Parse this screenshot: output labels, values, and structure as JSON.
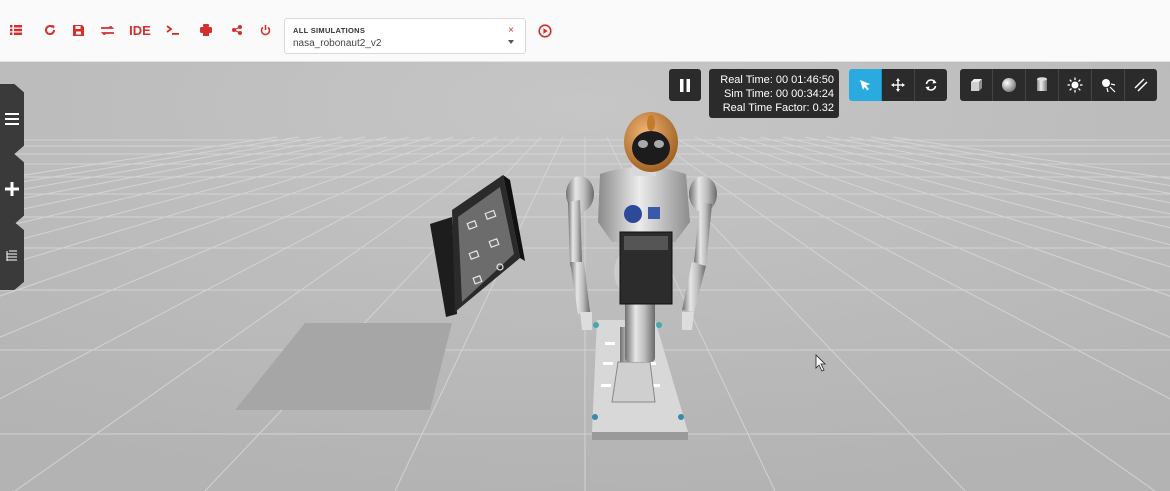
{
  "toolbar": {
    "items": [
      {
        "icon": "list-icon",
        "label": ""
      },
      {
        "icon": "refresh-icon",
        "label": ""
      },
      {
        "icon": "save-icon",
        "label": ""
      },
      {
        "icon": "swap-icon",
        "label": ""
      },
      {
        "icon": "ide-text-icon",
        "label": "IDE"
      },
      {
        "icon": "terminal-icon",
        "label": ""
      },
      {
        "icon": "robot-icon",
        "label": ""
      },
      {
        "icon": "share-icon",
        "label": ""
      },
      {
        "icon": "power-icon",
        "label": ""
      }
    ],
    "ide_label": "IDE",
    "accent_color": "#d32f2f"
  },
  "simulation_select": {
    "label": "ALL SIMULATIONS",
    "value": "nasa_robonaut2_v2",
    "clear_symbol": "×"
  },
  "play_icon": "play-circle-icon",
  "side_tabs": [
    "menu-icon",
    "plus-icon",
    "tree-icon"
  ],
  "time": {
    "real_time": "Real Time: 00 01:46:50",
    "sim_time": "Sim Time: 00 00:34:24",
    "factor": "Real Time Factor: 0.32"
  },
  "controls": {
    "pause_icon": "pause-icon",
    "modes": [
      "select-arrow-icon",
      "translate-icon",
      "rotate-icon"
    ],
    "active_mode": "select-arrow-icon",
    "shapes": [
      "box-icon",
      "sphere-icon",
      "cylinder-icon",
      "point-light-icon",
      "spot-light-icon",
      "directional-light-icon"
    ]
  },
  "colors": {
    "viewport_bg": "#bdbdbd",
    "active_blue": "#29abe0",
    "toolbar_bg": "#fafafa"
  }
}
